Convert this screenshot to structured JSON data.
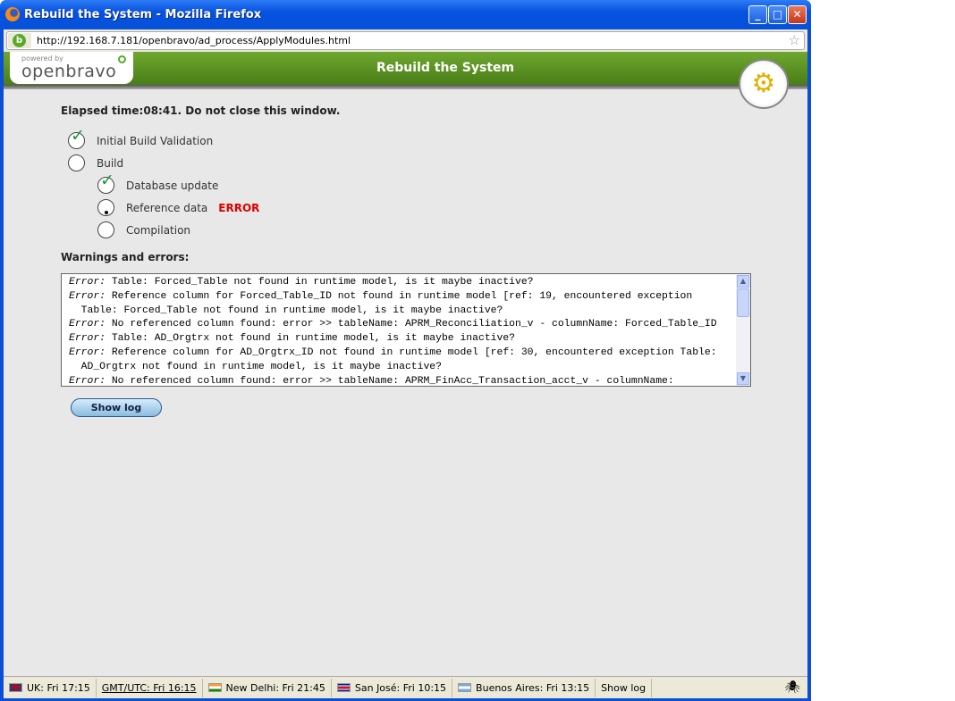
{
  "window": {
    "title": "Rebuild the System - Mozilla Firefox",
    "url": "http://192.168.7.181/openbravo/ad_process/ApplyModules.html"
  },
  "header": {
    "title": "Rebuild the System",
    "logo_powered": "powered by",
    "logo_name": "openbravo"
  },
  "elapsed": "Elapsed time:08:41. Do not close this window.",
  "steps": [
    {
      "label": "Initial Build Validation",
      "state": "done"
    },
    {
      "label": "Build",
      "state": "pending"
    },
    {
      "label": "Database update",
      "state": "done"
    },
    {
      "label": "Reference data",
      "state": "running",
      "error": "ERROR"
    },
    {
      "label": "Compilation",
      "state": "pending"
    }
  ],
  "warnings_title": "Warnings and errors:",
  "log": [
    {
      "prefix": "Error:",
      "text": " Table: Forced_Table not found in runtime model, is it maybe inactive?"
    },
    {
      "prefix": "Error:",
      "text": " Reference column for Forced_Table_ID not found in runtime model [ref: 19, encountered exception"
    },
    {
      "prefix": "",
      "text": "  Table: Forced_Table not found in runtime model, is it maybe inactive?"
    },
    {
      "prefix": "Error:",
      "text": " No referenced column found: error >> tableName: APRM_Reconciliation_v - columnName: Forced_Table_ID"
    },
    {
      "prefix": "Error:",
      "text": " Table: AD_Orgtrx not found in runtime model, is it maybe inactive?"
    },
    {
      "prefix": "Error:",
      "text": " Reference column for AD_Orgtrx_ID not found in runtime model [ref: 30, encountered exception Table:"
    },
    {
      "prefix": "",
      "text": "  AD_Orgtrx not found in runtime model, is it maybe inactive?"
    },
    {
      "prefix": "Error:",
      "text": " No referenced column found: error >> tableName: APRM_FinAcc_Transaction_acct_v - columnName:"
    }
  ],
  "show_log_button": "Show log",
  "statusbar": [
    {
      "label": "UK: Fri 17:15",
      "flag": "uk"
    },
    {
      "label": "GMT/UTC: Fri 16:15",
      "flag": ""
    },
    {
      "label": "New Delhi: Fri 21:45",
      "flag": "india"
    },
    {
      "label": "San José: Fri 10:15",
      "flag": "costa-rica"
    },
    {
      "label": "Buenos Aires: Fri 13:15",
      "flag": "argentina"
    },
    {
      "label": "Show log",
      "flag": ""
    }
  ]
}
